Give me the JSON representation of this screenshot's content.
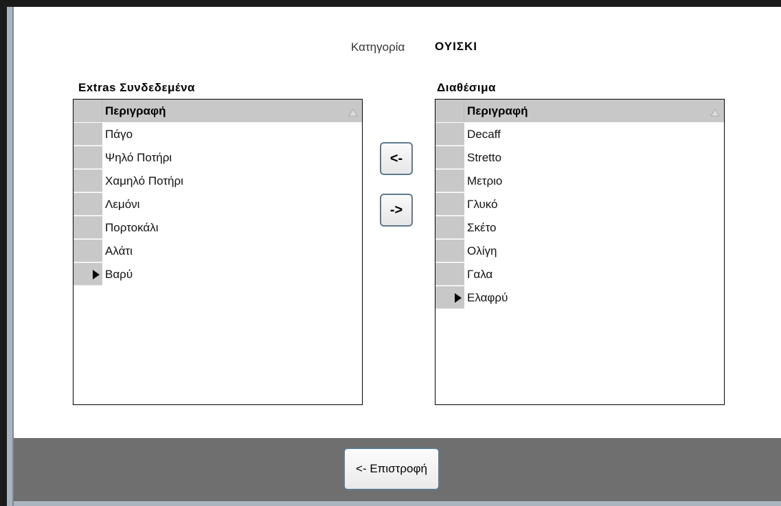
{
  "category": {
    "label": "Κατηγορία",
    "value": "ΟΥΙΣΚΙ"
  },
  "linked": {
    "title": "Extras  Συνδεδεμένα",
    "column_header": "Περιγραφή",
    "rows": [
      "Πάγο",
      "Ψηλό Ποτήρι",
      "Χαμηλό Ποτήρι",
      "Λεμόνι",
      "Πορτοκάλι",
      "Αλάτι",
      "Βαρύ"
    ],
    "current_row_index": 6
  },
  "available": {
    "title": "Διαθέσιμα",
    "column_header": "Περιγραφή",
    "rows": [
      "Decaff",
      "Stretto",
      "Μετριο",
      "Γλυκό",
      "Σκέτο",
      "Ολίγη",
      "Γαλα",
      "Ελαφρύ"
    ],
    "current_row_index": 7
  },
  "buttons": {
    "add": "<-",
    "remove": "->",
    "back": "<- Επιστροφή"
  },
  "icons": {
    "sort": "sort-ascending-icon",
    "row_pointer": "current-row-pointer-icon"
  },
  "colors": {
    "header_bg": "#c8c8c8",
    "footer_bg": "#6f6f6f",
    "button_border": "#5d7a8e"
  }
}
